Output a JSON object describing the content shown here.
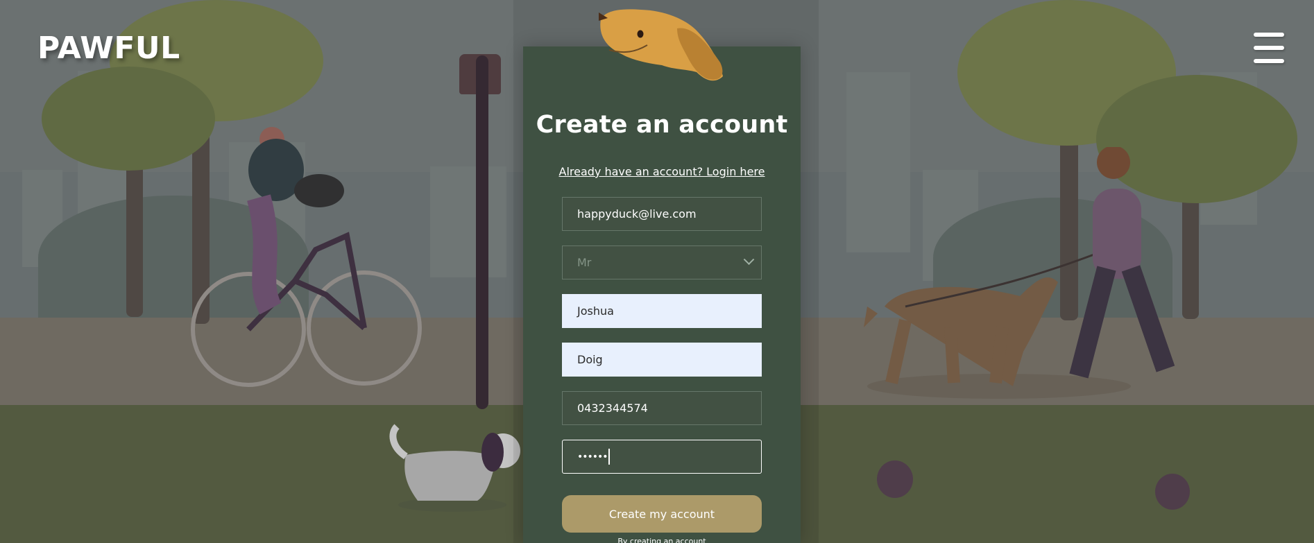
{
  "brand": {
    "name": "PAWFUL"
  },
  "header": {
    "menu_icon": "hamburger-menu-icon"
  },
  "signup": {
    "title": "Create an account",
    "login_link": "Already have an account? Login here",
    "email": "happyduck@live.com",
    "salutation": "Mr",
    "first_name": "Joshua",
    "last_name": "Doig",
    "phone": "0432344574",
    "password_mask": "••••••",
    "submit_label": "Create my account",
    "terms_text": "By creating an account"
  },
  "colors": {
    "card": "#3f5142",
    "button": "#ac9a69",
    "autofill": "#e8f0fd",
    "text": "#ffffff"
  }
}
